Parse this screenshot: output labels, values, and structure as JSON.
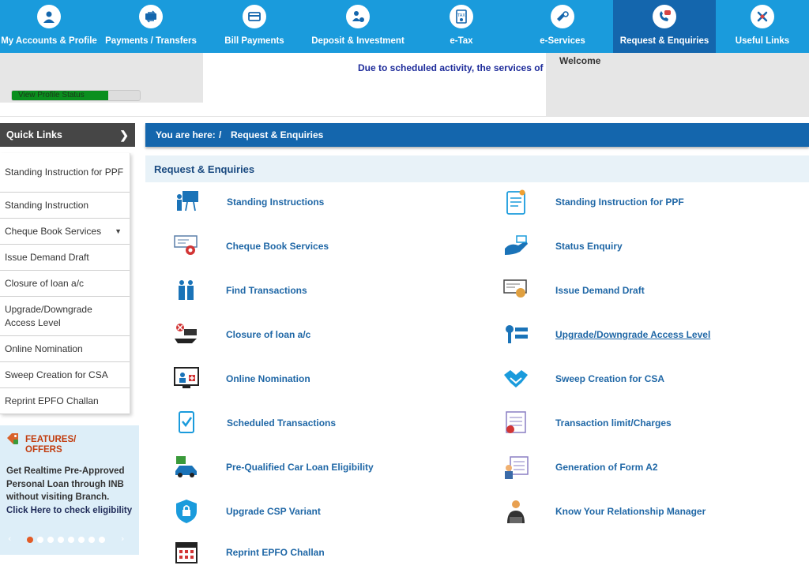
{
  "nav": {
    "items": [
      {
        "label": "My Accounts & Profile",
        "icon": "user-icon"
      },
      {
        "label": "Payments / Transfers",
        "icon": "transfer-icon"
      },
      {
        "label": "Bill Payments",
        "icon": "bill-icon"
      },
      {
        "label": "Deposit & Investment",
        "icon": "deposit-icon"
      },
      {
        "label": "e-Tax",
        "icon": "tax-icon"
      },
      {
        "label": "e-Services",
        "icon": "eservices-icon"
      },
      {
        "label": "Request & Enquiries",
        "icon": "phone-chat-icon"
      },
      {
        "label": "Useful Links",
        "icon": "links-icon"
      }
    ],
    "active_color": "#1466ad",
    "bar_color": "#1a9bdc"
  },
  "profile": {
    "status_label": "View Profile Status",
    "progress": 0.75
  },
  "marquee": {
    "text": "Due to scheduled activity, the services of"
  },
  "welcome": {
    "text": "Welcome"
  },
  "quick_links": {
    "title": "Quick Links",
    "items": [
      "Standing Instruction for PPF",
      "Standing Instruction",
      "Cheque Book Services",
      "Issue Demand Draft",
      "Closure of loan a/c",
      "Upgrade/Downgrade Access Level",
      "Online Nomination",
      "Sweep Creation for CSA",
      "Reprint EPFO Challan"
    ]
  },
  "features": {
    "title_line1": "FEATURES/",
    "title_line2": "OFFERS",
    "text": "Get Realtime Pre-Approved Personal Loan through INB without visiting Branch.",
    "link": "Click Here to check eligibility"
  },
  "breadcrumb": {
    "prefix": "You are here:",
    "sep": "/",
    "current": "Request & Enquiries"
  },
  "main": {
    "title": "Request & Enquiries",
    "left": [
      {
        "label": "Standing Instructions",
        "icon": "presenter-board-icon"
      },
      {
        "label": "Cheque Book Services",
        "icon": "cheque-gear-icon"
      },
      {
        "label": "Find Transactions",
        "icon": "people-search-icon"
      },
      {
        "label": "Closure of loan a/c",
        "icon": "loan-closure-icon"
      },
      {
        "label": "Online Nomination",
        "icon": "monitor-nomination-icon"
      },
      {
        "label": "Scheduled Transactions",
        "icon": "checklist-icon"
      },
      {
        "label": "Pre-Qualified Car Loan Eligibility",
        "icon": "car-loan-icon"
      },
      {
        "label": "Upgrade CSP Variant",
        "icon": "shield-lock-icon"
      },
      {
        "label": "Reprint EPFO Challan",
        "icon": "calendar-icon"
      }
    ],
    "right": [
      {
        "label": "Standing Instruction for PPF",
        "icon": "document-icon"
      },
      {
        "label": "Status Enquiry",
        "icon": "hand-card-icon"
      },
      {
        "label": "Issue Demand Draft",
        "icon": "draft-icon"
      },
      {
        "label": "Upgrade/Downgrade Access Level",
        "icon": "key-list-icon"
      },
      {
        "label": "Sweep Creation for CSA",
        "icon": "handshake-icon"
      },
      {
        "label": "Transaction limit/Charges",
        "icon": "limit-form-icon"
      },
      {
        "label": "Generation of Form A2",
        "icon": "form-a2-icon"
      },
      {
        "label": "Know Your Relationship Manager",
        "icon": "manager-icon"
      }
    ]
  }
}
